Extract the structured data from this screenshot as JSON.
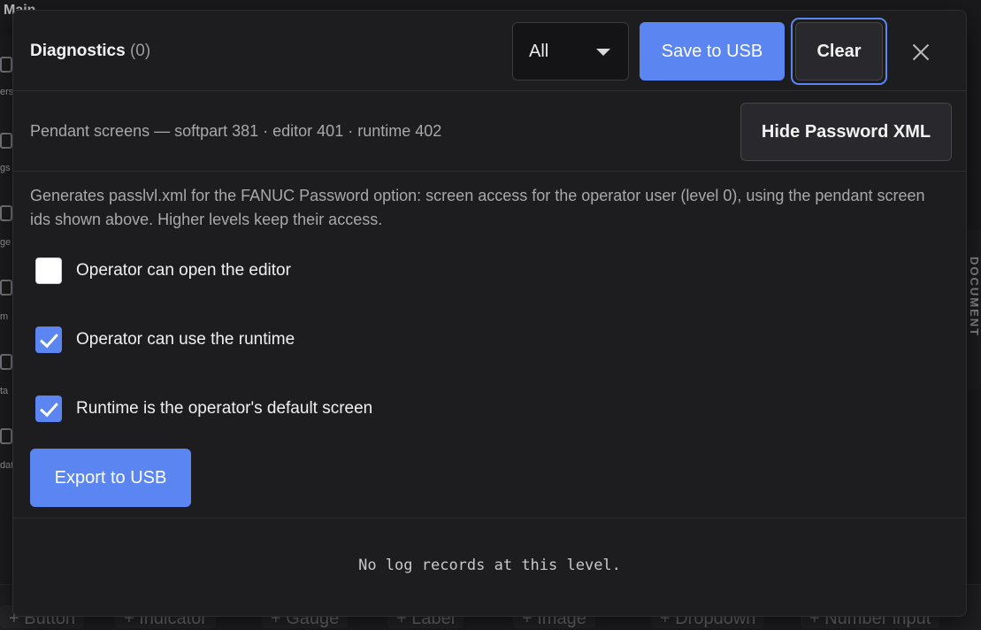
{
  "background": {
    "title": "Main",
    "left_labels": [
      "ers",
      "gs",
      "ge",
      "m",
      "ta",
      "dat"
    ],
    "right_panel_label": "DOCUMENT",
    "palette": [
      "+ Button",
      "+ Indicator",
      "+ Gauge",
      "+ Label",
      "+ Image",
      "+ Dropdown",
      "+ Number input"
    ]
  },
  "modal": {
    "title": "Diagnostics",
    "count": "(0)",
    "level_select": {
      "value": "All"
    },
    "save_button": "Save to USB",
    "clear_button": "Clear",
    "screens_text": "Pendant screens — softpart 381 · editor 401 · runtime 402",
    "hide_xml_button": "Hide Password XML",
    "description": "Generates passlvl.xml for the FANUC Password option: screen access for the operator user (level 0), using the pendant screen ids shown above. Higher levels keep their access.",
    "options": [
      {
        "label": "Operator can open the editor",
        "checked": false
      },
      {
        "label": "Operator can use the runtime",
        "checked": true
      },
      {
        "label": "Runtime is the operator's default screen",
        "checked": true
      }
    ],
    "export_button": "Export to USB",
    "empty_text": "No log records at this level."
  },
  "colors": {
    "accent": "#5b85f0",
    "modal_bg": "#1d1d1f",
    "button_dark": "#29292d"
  }
}
